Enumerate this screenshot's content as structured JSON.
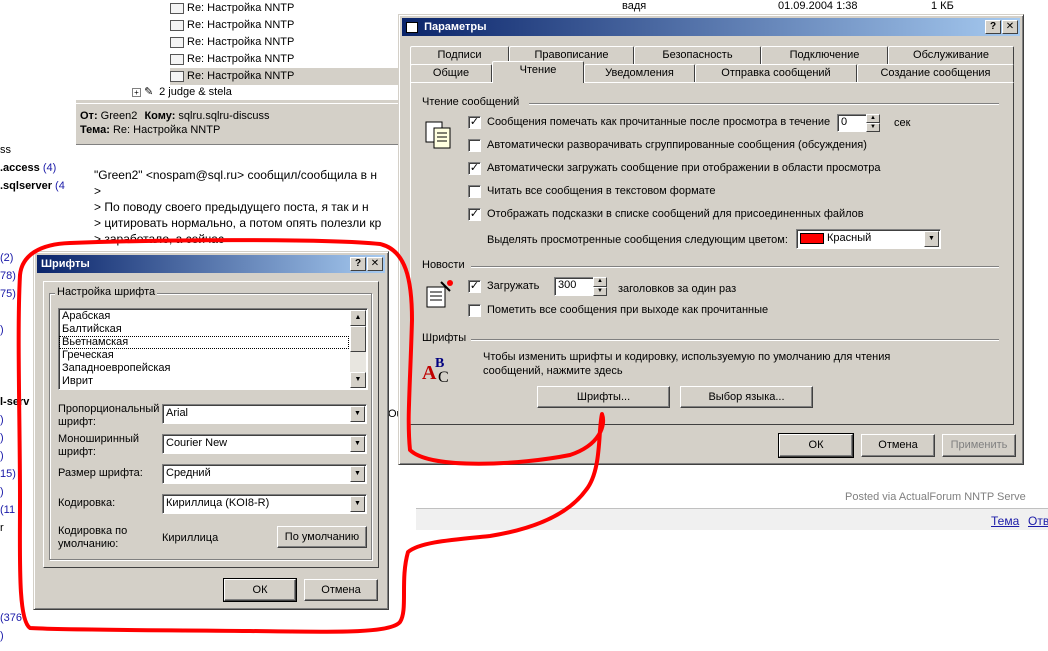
{
  "background": {
    "tree_rows": [
      "Re: Настройка NNTP",
      "Re: Настройка NNTP",
      "Re: Настройка NNTP",
      "Re: Настройка NNTP",
      "Re: Настройка NNTP"
    ],
    "thread_row": "2 judge & stela",
    "top_row": {
      "author": "вадя",
      "date": "01.09.2004 1:38",
      "size": "1 КБ"
    },
    "header": {
      "from_label": "От:",
      "from_value": "Green2",
      "to_label": "Кому:",
      "to_value": "sqlru.sqlru-discuss",
      "subject_label": "Тема:",
      "subject_value": "Re: Настройка NNTP"
    },
    "body_lines": [
      "\"Green2\" <nospam@sql.ru> сообщил/сообщила в н",
      ">",
      "> По поводу своего предыдущего поста, я так и н",
      "> цитировать нормально, а потом опять полезли кр",
      "> заработало, а сейчас"
    ],
    "left_items": [
      {
        "text": "ss",
        "count": ""
      },
      {
        "text": ".access",
        "count": "(4)"
      },
      {
        "text": ".sqlserver",
        "count": "(4"
      },
      {
        "text": "",
        "count": "(2)"
      },
      {
        "text": "",
        "count": "78)"
      },
      {
        "text": "",
        "count": "75)"
      },
      {
        "text": "",
        "count": ")"
      },
      {
        "text": "l-serv",
        "count": ""
      },
      {
        "text": "",
        "count": ")"
      },
      {
        "text": "",
        "count": ")"
      },
      {
        "text": "",
        "count": ")"
      },
      {
        "text": "",
        "count": "15)"
      },
      {
        "text": "",
        "count": ")"
      },
      {
        "text": "",
        "count": "(11"
      },
      {
        "text": "r",
        "count": ""
      },
      {
        "text": "",
        "count": "(376"
      },
      {
        "text": "",
        "count": ")"
      }
    ],
    "posted_via": "Posted via ActualForum NNTP Serve",
    "bottom_links": [
      "Тема",
      "Отв"
    ],
    "stray_text": "Ou"
  },
  "params_dialog": {
    "title": "Параметры",
    "help_btn": "?",
    "close_btn": "✕",
    "tabs_back": [
      "Подписи",
      "Правописание",
      "Безопасность",
      "Подключение",
      "Обслуживание"
    ],
    "tabs_front": [
      "Общие",
      "Чтение",
      "Уведомления",
      "Отправка сообщений",
      "Создание сообщения"
    ],
    "active_tab": "Чтение",
    "reading": {
      "section": "Чтение сообщений",
      "opt_mark_read": "Сообщения помечать как прочитанные после просмотра в течение",
      "mark_read_seconds": "0",
      "sec_label": "сек",
      "opt_expand": "Автоматически разворачивать сгруппированные сообщения (обсуждения)",
      "opt_autoload": "Автоматически загружать сообщение при отображении в области просмотра",
      "opt_plaintext": "Читать все сообщения в текстовом формате",
      "opt_tooltips": "Отображать подсказки в списке сообщений для присоединенных файлов",
      "highlight_label": "Выделять просмотренные сообщения следующим цветом:",
      "highlight_color_name": "Красный",
      "highlight_color": "#ff0000"
    },
    "news": {
      "section": "Новости",
      "opt_download": "Загружать",
      "download_count": "300",
      "download_suffix": "заголовков за один раз",
      "opt_mark_all": "Пометить все сообщения при выходе как прочитанные"
    },
    "fonts": {
      "section": "Шрифты",
      "desc_line1": "Чтобы изменить шрифты и кодировку, используемую по умолчанию для чтения",
      "desc_line2": "сообщений, нажмите здесь",
      "fonts_btn": "Шрифты...",
      "language_btn": "Выбор языка..."
    },
    "ok_btn": "ОК",
    "cancel_btn": "Отмена",
    "apply_btn": "Применить"
  },
  "fonts_dialog": {
    "title": "Шрифты",
    "help_btn": "?",
    "close_btn": "✕",
    "group_title": "Настройка шрифта",
    "scripts": [
      "Арабская",
      "Балтийская",
      "Вьетнамская",
      "Греческая",
      "Западноевропейская",
      "Иврит"
    ],
    "focused_index": 2,
    "proportional_label_1": "Пропорциональный",
    "proportional_label_2": "шрифт:",
    "proportional_value": "Arial",
    "mono_label_1": "Моноширинный",
    "mono_label_2": "шрифт:",
    "mono_value": "Courier New",
    "size_label": "Размер шрифта:",
    "size_value": "Средний",
    "encoding_label": "Кодировка:",
    "encoding_value": "Кириллица (KOI8-R)",
    "default_enc_label_1": "Кодировка по",
    "default_enc_label_2": "умолчанию:",
    "default_enc_value": "Кириллица",
    "default_btn": "По умолчанию",
    "ok_btn": "ОК",
    "cancel_btn": "Отмена"
  },
  "colors": {
    "title_start": "#0a246a",
    "title_end": "#a6caf0",
    "face": "#d4d0c8",
    "annotation_red": "#ff0000"
  }
}
